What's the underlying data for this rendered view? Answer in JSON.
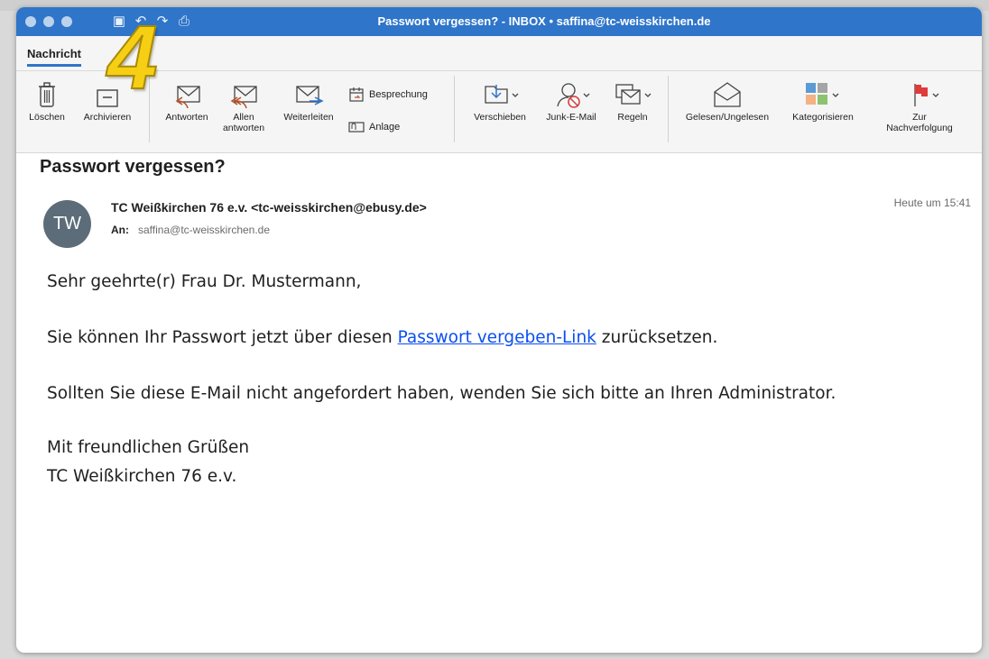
{
  "window": {
    "title": "Passwort vergessen? - INBOX • saffina@tc-weisskirchen.de"
  },
  "ribbon": {
    "tab": "Nachricht",
    "buttons": {
      "delete": "Löschen",
      "archive": "Archivieren",
      "reply": "Antworten",
      "reply_all_1": "Allen",
      "reply_all_2": "antworten",
      "forward": "Weiterleiten",
      "meeting": "Besprechung",
      "attachment": "Anlage",
      "move": "Verschieben",
      "junk": "Junk-E-Mail",
      "rules": "Regeln",
      "read_unread": "Gelesen/Ungelesen",
      "categorize": "Kategorisieren",
      "followup_1": "Zur",
      "followup_2": "Nachverfolgung"
    }
  },
  "annotation": {
    "number": "4"
  },
  "email": {
    "subject": "Passwort vergessen?",
    "avatar_initials": "TW",
    "sender": "TC Weißkirchen 76 e.v. <tc-weisskirchen@ebusy.de>",
    "to_label": "An:",
    "to": "saffina@tc-weisskirchen.de",
    "date": "Heute um 15:41",
    "greeting": "Sehr geehrte(r) Frau Dr. Mustermann,",
    "line1_before": "Sie können Ihr Passwort jetzt über diesen ",
    "line1_link": "Passwort vergeben-Link",
    "line1_after": " zurücksetzen.",
    "line2": "Sollten Sie diese E-Mail nicht angefordert haben, wenden Sie sich bitte an Ihren Administrator.",
    "closing": "Mit freundlichen Grüßen",
    "signature": "TC Weißkirchen 76 e.v."
  },
  "colors": {
    "titlebar": "#2f75c9",
    "link": "#0b4ff0",
    "avatar": "#5c6c78",
    "badge": "#f6cf15",
    "flag": "#e03a3a"
  },
  "icons": [
    "trash-icon",
    "archive-icon",
    "reply-icon",
    "reply-all-icon",
    "forward-icon",
    "calendar-icon",
    "attachment-icon",
    "move-icon",
    "junk-icon",
    "rules-icon",
    "envelope-open-icon",
    "categories-icon",
    "flag-icon"
  ]
}
